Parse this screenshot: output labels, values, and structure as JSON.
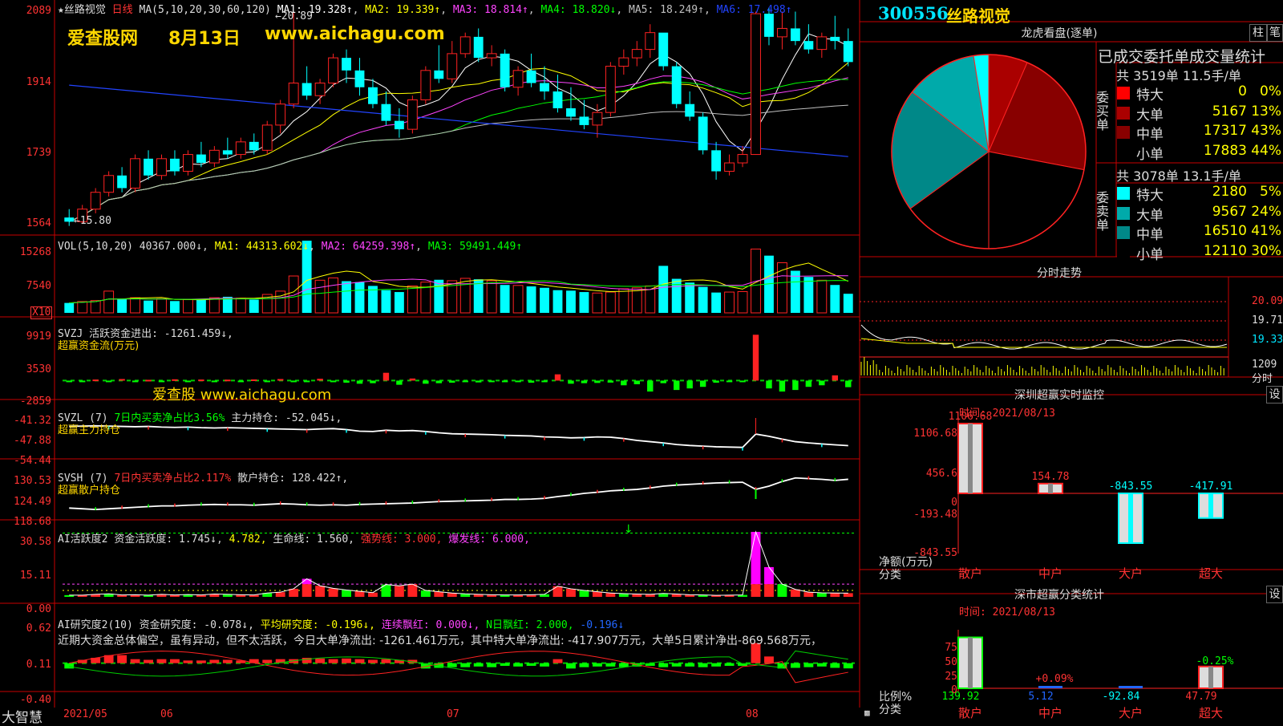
{
  "stock": {
    "code": "300556",
    "name": "丝路视觉"
  },
  "watermark": {
    "site": "爱查股网",
    "date": "8月13日",
    "url": "www.aichagu.com",
    "mid": "爱查股 www.aichagu.com"
  },
  "kline": {
    "title_prefix": "★丝路视觉",
    "period": "日线",
    "ma_def": "MA(5,10,20,30,60,120)",
    "ma": [
      {
        "label": "MA1: 19.328↑",
        "color": "#ffffff"
      },
      {
        "label": "MA2: 19.339↑",
        "color": "#ffff00"
      },
      {
        "label": "MA3: 18.814↑",
        "color": "#ff44ff"
      },
      {
        "label": "MA4: 18.820↓",
        "color": "#00ff00"
      },
      {
        "label": "MA5: 18.249↑",
        "color": "#c0c0c0"
      },
      {
        "label": "MA6: 17.498↑",
        "color": "#2244ff"
      }
    ],
    "high_mark": "20.89",
    "low_mark": "15.80",
    "yticks": [
      "2089",
      "1914",
      "1739",
      "1564"
    ]
  },
  "vol": {
    "title": "VOL(5,10,20)",
    "value": "40367.000↓",
    "ma1": "MA1: 44313.602↓",
    "ma2": "MA2: 64259.398↑",
    "ma3": "MA3: 59491.449↑",
    "yticks": [
      "15268",
      "7540"
    ],
    "unit": "X10"
  },
  "svzj": {
    "title": "SVZJ",
    "desc": "活跃资金进出: -1261.459↓,",
    "sub": "超赢资金流(万元)",
    "yticks": [
      "9919",
      "3530",
      "-2859"
    ]
  },
  "svzl": {
    "title": "SVZL (7)",
    "desc1": "7日内买卖净占比3.56%",
    "desc2": "主力持仓: -52.045↓,",
    "sub": "超赢主力持仓",
    "yticks": [
      "-41.32",
      "-47.88",
      "-54.44"
    ]
  },
  "svsh": {
    "title": "SVSH (7)",
    "desc1": "7日内买卖净占比2.117%",
    "desc2": "散户持仓: 128.422↑,",
    "sub": "超赢散户持仓",
    "yticks": [
      "130.53",
      "124.49",
      "118.68"
    ]
  },
  "ai1": {
    "title": "AI活跃度2",
    "v1": "资金活跃度: 1.745↓",
    "v2": "4.782,",
    "v3": "生命线: 1.560,",
    "v4": "强势线: 3.000,",
    "v5": "爆发线: 6.000,",
    "yticks": [
      "30.58",
      "15.11",
      "0.00"
    ]
  },
  "ai2": {
    "title": "AI研究度2(10)",
    "v1": "资金研究度: -0.078↓,",
    "v2": "平均研究度: -0.196↓,",
    "v3": "连续飘红: 0.000↓,",
    "v4": "N日飘红: 2.000,",
    "v5": "-0.196↓",
    "note": "近期大资金总体偏空，虽有异动，但不太活跃，今日大单净流出: -1261.461万元，其中特大单净流出: -417.907万元，大单5日累计净出-869.568万元，",
    "yticks": [
      "0.62",
      "0.11",
      "-0.40"
    ]
  },
  "xaxis": {
    "brand": "大智慧",
    "labels": [
      "2021/05",
      "06",
      "07",
      "08"
    ]
  },
  "dragon": {
    "title": "龙虎看盘(逐单)",
    "btn1": "柱",
    "btn2": "笔",
    "stat_title": "已成交委托单成交量统计",
    "buy_side": "委买单",
    "sell_side": "委卖单",
    "buy_total": "共 3519单 11.5手/单",
    "sell_total": "共 3078单 13.1手/单",
    "buy_rows": [
      {
        "name": "特大",
        "vol": "0",
        "pct": "0%",
        "color": "#ff0000"
      },
      {
        "name": "大单",
        "vol": "5167",
        "pct": "13%",
        "color": "#aa0000"
      },
      {
        "name": "中单",
        "vol": "17317",
        "pct": "43%",
        "color": "#880000"
      },
      {
        "name": "小单",
        "vol": "17883",
        "pct": "44%",
        "color": "#000000"
      }
    ],
    "sell_rows": [
      {
        "name": "特大",
        "vol": "2180",
        "pct": "5%",
        "color": "#00ffff"
      },
      {
        "name": "大单",
        "vol": "9567",
        "pct": "24%",
        "color": "#00aaaa"
      },
      {
        "name": "中单",
        "vol": "16510",
        "pct": "41%",
        "color": "#008888"
      },
      {
        "name": "小单",
        "vol": "12110",
        "pct": "30%",
        "color": "#000000"
      }
    ]
  },
  "intraday": {
    "title": "分时走势",
    "yticks": [
      "20.09",
      "19.71",
      "19.33",
      "1209"
    ],
    "footer": "分时"
  },
  "monitor": {
    "title": "深圳超赢实时监控",
    "btn": "设",
    "time": "时间: 2021/08/13",
    "yticks": [
      "1106.68",
      "456.6",
      "0",
      "-193.48",
      "-843.55"
    ],
    "ylabel": "净额(万元)",
    "xlabel": "分类",
    "bars": [
      {
        "cat": "散户",
        "value": 1106.68,
        "label": "1106.68"
      },
      {
        "cat": "中户",
        "value": 154.78,
        "label": "154.78"
      },
      {
        "cat": "大户",
        "value": -843.55,
        "label": "-843.55"
      },
      {
        "cat": "超大",
        "value": -417.91,
        "label": "-417.91"
      }
    ]
  },
  "classify": {
    "title": "深市超赢分类统计",
    "btn": "设",
    "time": "时间: 2021/08/13",
    "yticks": [
      "75",
      "50",
      "25",
      "0"
    ],
    "ylabel": "比例%",
    "xlabel": "分类",
    "bars": [
      {
        "cat": "散户",
        "pct": 70,
        "label": "",
        "bottom": "139.92"
      },
      {
        "cat": "中户",
        "pct": 0.09,
        "label": "+0.09%",
        "bottom": "5.12"
      },
      {
        "cat": "大户",
        "pct": 0,
        "label": "",
        "bottom": "-92.84"
      },
      {
        "cat": "超大",
        "pct": 30,
        "label": "-0.25%",
        "bottom": "47.79"
      }
    ]
  },
  "chart_data": [
    {
      "type": "candlestick",
      "title": "丝路视觉 日线",
      "ylim": [
        15.64,
        20.89
      ],
      "note": "daily OHLC approx, 2021/05 - 2021/08/13, 60 sessions",
      "ohlc": [
        [
          16.0,
          16.2,
          15.8,
          15.9
        ],
        [
          15.9,
          16.3,
          15.85,
          16.2
        ],
        [
          16.2,
          16.7,
          16.1,
          16.6
        ],
        [
          16.6,
          17.1,
          16.5,
          17.0
        ],
        [
          17.0,
          17.2,
          16.6,
          16.7
        ],
        [
          16.7,
          17.5,
          16.6,
          17.4
        ],
        [
          17.4,
          17.6,
          16.9,
          17.0
        ],
        [
          17.0,
          17.5,
          16.9,
          17.4
        ],
        [
          17.4,
          17.6,
          17.0,
          17.1
        ],
        [
          17.1,
          17.6,
          17.0,
          17.5
        ],
        [
          17.5,
          17.8,
          17.2,
          17.3
        ],
        [
          17.3,
          17.7,
          17.2,
          17.6
        ],
        [
          17.6,
          17.9,
          17.4,
          17.5
        ],
        [
          17.5,
          17.9,
          17.4,
          17.8
        ],
        [
          17.8,
          18.0,
          17.5,
          17.6
        ],
        [
          17.6,
          18.3,
          17.5,
          18.2
        ],
        [
          18.2,
          18.8,
          18.0,
          18.7
        ],
        [
          18.7,
          20.89,
          18.6,
          19.2
        ],
        [
          19.2,
          19.6,
          18.8,
          18.9
        ],
        [
          18.9,
          19.3,
          18.7,
          19.2
        ],
        [
          19.2,
          19.9,
          19.1,
          19.8
        ],
        [
          19.8,
          20.0,
          19.2,
          19.5
        ],
        [
          19.5,
          19.8,
          18.9,
          19.1
        ],
        [
          19.1,
          19.3,
          18.6,
          18.7
        ],
        [
          18.7,
          19.0,
          18.2,
          18.3
        ],
        [
          18.3,
          18.6,
          17.9,
          18.1
        ],
        [
          18.1,
          18.9,
          18.0,
          18.8
        ],
        [
          18.8,
          19.6,
          18.7,
          19.5
        ],
        [
          19.5,
          20.1,
          19.2,
          19.3
        ],
        [
          19.3,
          20.2,
          19.2,
          19.9
        ],
        [
          19.9,
          20.4,
          19.8,
          20.3
        ],
        [
          20.3,
          20.5,
          19.7,
          19.8
        ],
        [
          19.8,
          20.1,
          19.6,
          19.9
        ],
        [
          19.9,
          20.0,
          19.0,
          19.1
        ],
        [
          19.1,
          19.6,
          18.9,
          19.5
        ],
        [
          19.5,
          19.9,
          19.1,
          19.2
        ],
        [
          19.2,
          19.6,
          18.8,
          19.0
        ],
        [
          19.0,
          19.4,
          18.5,
          18.6
        ],
        [
          18.6,
          19.1,
          18.3,
          18.4
        ],
        [
          18.4,
          18.8,
          18.1,
          18.2
        ],
        [
          18.2,
          18.7,
          17.9,
          18.5
        ],
        [
          18.5,
          19.7,
          18.4,
          19.6
        ],
        [
          19.6,
          20.0,
          19.4,
          19.8
        ],
        [
          19.8,
          20.2,
          19.6,
          20.0
        ],
        [
          20.0,
          20.6,
          19.8,
          20.4
        ],
        [
          20.4,
          20.3,
          19.5,
          19.6
        ],
        [
          19.6,
          19.7,
          18.6,
          18.7
        ],
        [
          18.7,
          19.0,
          18.3,
          18.4
        ],
        [
          18.4,
          18.5,
          17.5,
          17.6
        ],
        [
          17.6,
          17.8,
          16.9,
          17.1
        ],
        [
          17.1,
          17.5,
          17.0,
          17.3
        ],
        [
          17.3,
          17.7,
          17.2,
          17.5
        ],
        [
          17.5,
          20.9,
          17.5,
          20.85
        ],
        [
          20.85,
          21.0,
          20.1,
          20.3
        ],
        [
          20.3,
          20.9,
          20.0,
          20.5
        ],
        [
          20.5,
          20.9,
          20.1,
          20.2
        ],
        [
          20.2,
          20.6,
          19.9,
          20.0
        ],
        [
          20.0,
          20.4,
          19.8,
          20.3
        ],
        [
          20.3,
          20.8,
          20.0,
          20.2
        ],
        [
          20.2,
          20.5,
          19.6,
          19.7
        ]
      ]
    },
    {
      "type": "bar",
      "title": "VOL(5,10,20)",
      "ylim": [
        0,
        15268
      ],
      "values": [
        2100,
        2400,
        2600,
        4600,
        2900,
        3200,
        2600,
        3000,
        2500,
        2800,
        2900,
        3200,
        3400,
        3100,
        2800,
        3900,
        4600,
        7800,
        15268,
        6900,
        7400,
        6700,
        6500,
        5700,
        4800,
        4400,
        5700,
        6500,
        7000,
        6800,
        7300,
        7100,
        6800,
        5900,
        5800,
        5600,
        5300,
        4800,
        4700,
        4400,
        4200,
        4400,
        5100,
        5300,
        5700,
        9940,
        7200,
        6400,
        5500,
        4300,
        4400,
        4500,
        13500,
        12100,
        10600,
        8900,
        7600,
        6900,
        5900,
        4037
      ],
      "up": [
        0,
        1,
        1,
        1,
        0,
        1,
        0,
        1,
        0,
        1,
        0,
        1,
        0,
        1,
        0,
        1,
        1,
        1,
        0,
        1,
        1,
        0,
        0,
        0,
        0,
        0,
        1,
        1,
        0,
        1,
        1,
        0,
        1,
        0,
        1,
        0,
        0,
        0,
        0,
        0,
        1,
        1,
        1,
        1,
        1,
        0,
        0,
        0,
        0,
        0,
        1,
        1,
        1,
        0,
        1,
        0,
        0,
        1,
        0,
        0
      ]
    },
    {
      "type": "bar",
      "title": "SVZJ 超赢资金流(万元)",
      "ylim": [
        -2859,
        9919
      ],
      "values": [
        -200,
        -150,
        200,
        -180,
        300,
        -220,
        150,
        -200,
        250,
        -170,
        200,
        -200,
        180,
        -160,
        220,
        -250,
        300,
        -180,
        -220,
        350,
        -300,
        -400,
        -600,
        -500,
        1500,
        -800,
        400,
        -600,
        -500,
        -400,
        -300,
        -350,
        -200,
        -300,
        -250,
        -400,
        -300,
        1200,
        -600,
        -500,
        -450,
        -380,
        -900,
        -700,
        -2100,
        -500,
        -1800,
        -1500,
        -1200,
        -400,
        -300,
        -200,
        8800,
        -1500,
        -2100,
        -1800,
        -1200,
        -900,
        1000,
        -1261
      ]
    },
    {
      "type": "line",
      "title": "SVZL 超赢主力持仓",
      "ylim": [
        -54.44,
        -41.32
      ],
      "values": [
        -46.0,
        -45.9,
        -45.8,
        -45.9,
        -46.0,
        -46.1,
        -46.0,
        -46.2,
        -46.3,
        -46.2,
        -46.4,
        -46.5,
        -46.4,
        -46.5,
        -46.6,
        -46.7,
        -46.8,
        -46.9,
        -47.0,
        -46.8,
        -46.7,
        -47.0,
        -47.5,
        -47.6,
        -47.2,
        -47.4,
        -47.3,
        -47.6,
        -48.0,
        -48.3,
        -48.4,
        -48.5,
        -48.6,
        -48.8,
        -48.9,
        -49.0,
        -49.3,
        -49.4,
        -49.6,
        -49.5,
        -49.3,
        -49.4,
        -49.8,
        -50.4,
        -50.8,
        -51.2,
        -51.7,
        -52.0,
        -52.2,
        -52.4,
        -52.5,
        -52.6,
        -48.4,
        -49.1,
        -50.0,
        -50.8,
        -51.2,
        -51.5,
        -51.8,
        -52.05
      ]
    },
    {
      "type": "line",
      "title": "SVSH 超赢散户持仓",
      "ylim": [
        118.68,
        130.53
      ],
      "values": [
        120.4,
        120.2,
        120.0,
        120.2,
        120.4,
        120.6,
        120.8,
        121.0,
        121.0,
        121.2,
        121.3,
        121.4,
        121.3,
        121.3,
        121.2,
        121.4,
        121.6,
        121.5,
        121.3,
        121.2,
        121.3,
        121.2,
        121.4,
        121.5,
        121.6,
        121.7,
        121.8,
        122.0,
        122.2,
        122.3,
        122.4,
        122.5,
        122.6,
        122.8,
        122.8,
        122.9,
        123.1,
        123.6,
        124.0,
        124.5,
        124.8,
        125.2,
        125.4,
        125.6,
        126.0,
        126.5,
        126.8,
        127.0,
        127.2,
        127.4,
        127.5,
        127.6,
        125.6,
        126.5,
        127.8,
        128.8,
        128.6,
        128.4,
        128.1,
        128.42
      ]
    },
    {
      "type": "bar",
      "title": "AI活跃度2",
      "ylim": [
        0,
        30.58
      ],
      "values": [
        0.8,
        0.8,
        1.2,
        1.4,
        0.9,
        1.0,
        0.8,
        1.2,
        0.9,
        1.1,
        0.9,
        1.3,
        1.2,
        1.0,
        0.9,
        1.8,
        2.2,
        3.8,
        8.5,
        5.2,
        4.0,
        3.2,
        2.6,
        2.0,
        5.8,
        5.2,
        6.0,
        3.0,
        2.4,
        1.8,
        1.4,
        1.2,
        1.0,
        0.9,
        0.9,
        1.0,
        1.2,
        5.0,
        3.8,
        3.0,
        2.4,
        1.8,
        1.5,
        1.3,
        1.2,
        1.6,
        1.3,
        1.0,
        0.9,
        0.7,
        0.8,
        0.9,
        30.58,
        14.0,
        6.0,
        3.5,
        2.2,
        1.9,
        1.8,
        1.745
      ]
    },
    {
      "type": "bar",
      "title": "AI研究度2(10)",
      "ylim": [
        -0.4,
        0.62
      ],
      "values": [
        -0.08,
        0.05,
        0.08,
        0.12,
        0.12,
        0.06,
        0.05,
        0.06,
        0.06,
        0.04,
        0.04,
        0.05,
        0.05,
        0.04,
        0.06,
        0.05,
        0.06,
        0.06,
        0.08,
        0.07,
        0.06,
        0.07,
        0.06,
        0.05,
        0.06,
        0.05,
        0.05,
        -0.08,
        -0.07,
        -0.06,
        -0.06,
        -0.05,
        -0.06,
        -0.04,
        -0.05,
        -0.04,
        -0.05,
        0.06,
        -0.08,
        -0.06,
        -0.05,
        -0.05,
        -0.06,
        -0.05,
        -0.04,
        -0.06,
        -0.05,
        -0.05,
        -0.06,
        -0.05,
        -0.04,
        -0.04,
        0.3,
        0.1,
        -0.08,
        -0.07,
        -0.06,
        -0.05,
        -0.07,
        -0.078
      ]
    },
    {
      "type": "pie",
      "title": "龙虎看盘(逐单)",
      "labels": [
        "卖特大",
        "卖大单",
        "卖中单",
        "卖小单",
        "买特大",
        "买大单",
        "买中单",
        "买小单"
      ],
      "values": [
        5,
        24,
        41,
        30,
        0,
        13,
        43,
        44
      ]
    },
    {
      "type": "bar",
      "title": "深圳超赢实时监控",
      "categories": [
        "散户",
        "中户",
        "大户",
        "超大"
      ],
      "values": [
        1106.68,
        154.78,
        -843.55,
        -417.91
      ],
      "ylim": [
        -843.55,
        1106.68
      ]
    },
    {
      "type": "bar",
      "title": "深市超赢分类统计",
      "categories": [
        "散户",
        "中户",
        "大户",
        "超大"
      ],
      "values": [
        139.92,
        5.12,
        -92.84,
        47.79
      ]
    }
  ]
}
